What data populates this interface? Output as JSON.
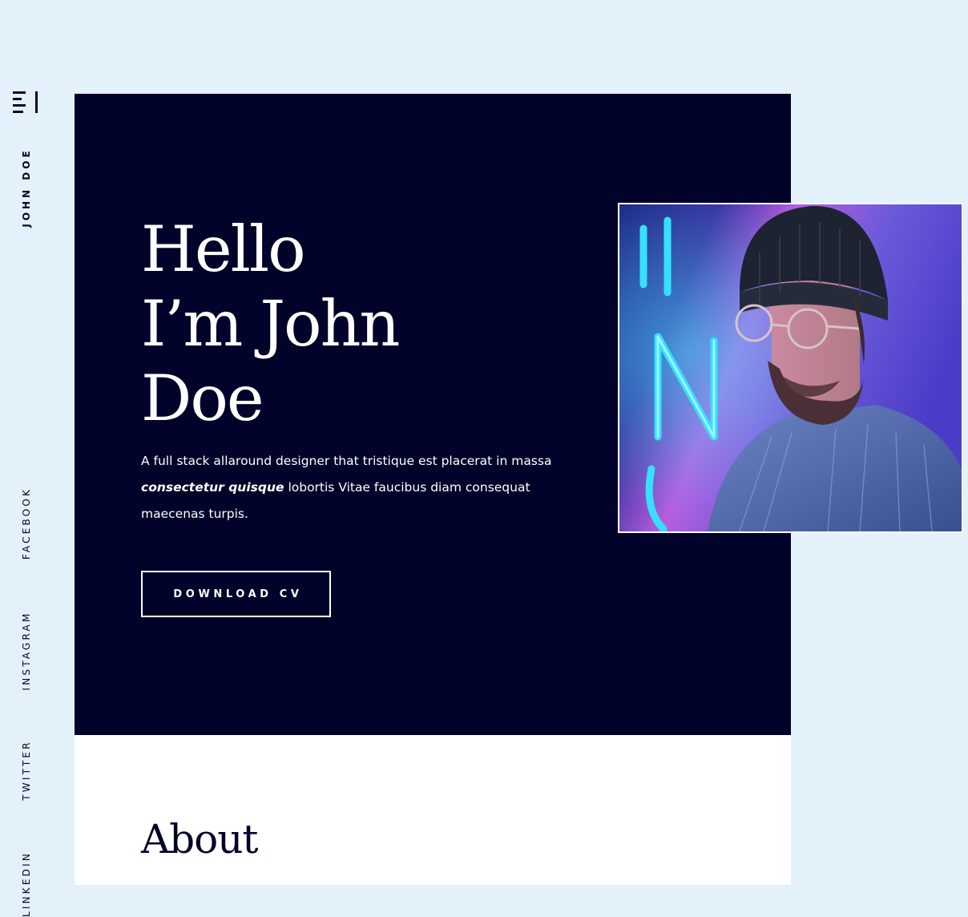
{
  "sidebar": {
    "menu_icon": "menu-icon",
    "brand": "JOHN DOE",
    "social": {
      "facebook": "FACEBOOK",
      "instagram": "INSTAGRAM",
      "twitter": "TWITTER",
      "linkedin": "LINKEDIN"
    }
  },
  "hero": {
    "title_lines": [
      "Hello",
      "I’m John",
      "Doe"
    ],
    "description_before": "A full stack allaround  designer that tristique est placerat in massa ",
    "description_emphasis": "consectetur quisque",
    "description_after": " lobortis Vitae faucibus diam consequat maecenas turpis.",
    "cta_label": "DOWNLOAD CV",
    "portrait_alt": "portrait-photo"
  },
  "about": {
    "title": "About"
  },
  "colors": {
    "page_background": "#e3f1fb",
    "hero_background": "#02032a",
    "text_light": "#ffffff",
    "text_dark": "#04062a",
    "neon_cyan": "#2fd6ff",
    "neon_magenta": "#c24dff"
  }
}
